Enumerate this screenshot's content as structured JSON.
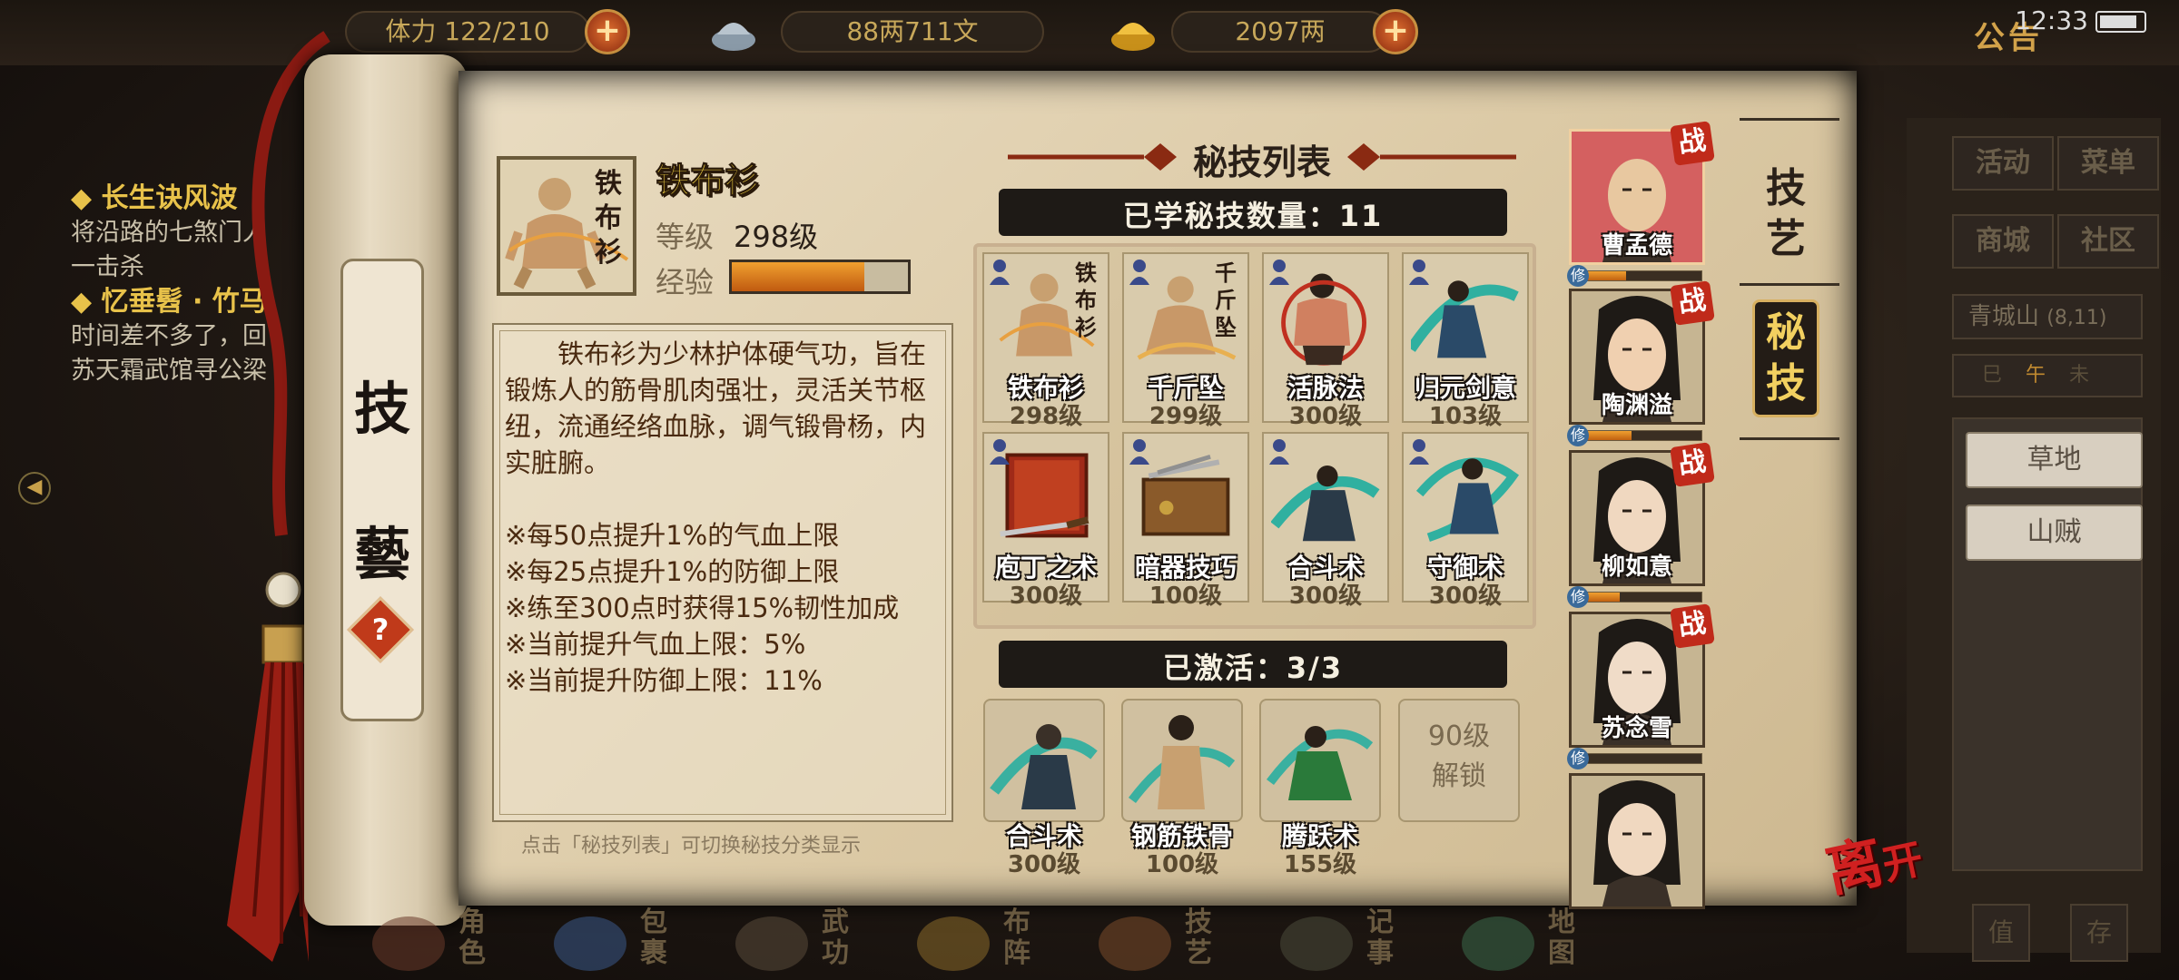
{
  "topbar": {
    "resource1_label": "体力",
    "resource1_value": "122/210",
    "resource2_value": "88两711文",
    "resource3_value": "2097两",
    "announcement": "公告",
    "time": "12:33"
  },
  "quest": {
    "q1_title": "长生诀风波",
    "q1_text_1": "将沿路的七煞门人",
    "q1_text_2": "一击杀",
    "q2_title": "忆垂髫 · 竹马",
    "q2_text_1": "时间差不多了，回",
    "q2_text_2": "苏天霜武馆寻公梁"
  },
  "scroll": {
    "char1": "技",
    "char2": "藝",
    "help": "?"
  },
  "selected_skill": {
    "name": "铁布衫",
    "portrait_text": "铁布衫",
    "level_label": "等级",
    "level_value": "298级",
    "exp_label": "经验",
    "exp_progress": 0.75
  },
  "description": {
    "intro": "铁布衫为少林护体硬气功，旨在锻炼人的筋骨肌肉强壮，灵活关节枢纽，流通经络血脉，调气锻骨杨，内实脏腑。",
    "effects": [
      "※每50点提升1%的气血上限",
      "※每25点提升1%的防御上限",
      "※练至300点时获得15%韧性加成",
      "※当前提升气血上限：5%",
      "※当前提升防御上限：11%"
    ],
    "hint": "点击「秘技列表」可切换秘技分类显示"
  },
  "list": {
    "title": "秘技列表",
    "learned_count": "已学秘技数量：11",
    "skills": [
      {
        "name": "铁布衫",
        "level": "298级",
        "icon": "bald-monk",
        "portrait_text": "铁布衫"
      },
      {
        "name": "千斤坠",
        "level": "299级",
        "icon": "meditating-monk",
        "portrait_text": "千斤坠"
      },
      {
        "name": "活脉法",
        "level": "300级",
        "icon": "muscle-fighter"
      },
      {
        "name": "归元剑意",
        "level": "103级",
        "icon": "swordsman"
      },
      {
        "name": "庖丁之术",
        "level": "300级",
        "icon": "red-book"
      },
      {
        "name": "暗器技巧",
        "level": "100级",
        "icon": "weapon-box"
      },
      {
        "name": "合斗术",
        "level": "300级",
        "icon": "dual-fighter"
      },
      {
        "name": "守御术",
        "level": "300级",
        "icon": "defense-fighter"
      }
    ],
    "activated_label": "已激活：3/3",
    "activated": [
      {
        "name": "合斗术",
        "level": "300级"
      },
      {
        "name": "钢筋铁骨",
        "level": "100级"
      },
      {
        "name": "腾跃术",
        "level": "155级"
      }
    ],
    "locked_line1": "90级",
    "locked_line2": "解锁"
  },
  "characters": [
    {
      "name": "曹孟德",
      "badge": "战",
      "xp": 0.35
    },
    {
      "name": "陶渊溢",
      "badge": "战",
      "xp": 0.4
    },
    {
      "name": "柳如意",
      "badge": "战",
      "xp": 0.3
    },
    {
      "name": "苏念雪",
      "badge": "战",
      "xp": 0.0
    },
    {
      "name": "",
      "badge": "",
      "xp": 0.0
    }
  ],
  "character_marker": "修",
  "tabs": {
    "jiyi": "技艺",
    "miji": "秘技"
  },
  "right_panel": {
    "btn_activity": "活动",
    "btn_menu": "菜单",
    "btn_shop": "商城",
    "btn_community": "社区",
    "location": "青城山",
    "coord": "(8,11)",
    "compass": [
      "巳",
      "午",
      "未"
    ],
    "npcs": [
      "草地",
      "山贼"
    ],
    "bottom_btn_1": "值",
    "bottom_btn_2": "存"
  },
  "leave": {
    "char1": "离",
    "char2": "开"
  },
  "nav": [
    {
      "label": "角色"
    },
    {
      "label": "包裹"
    },
    {
      "label": "武功"
    },
    {
      "label": "布阵"
    },
    {
      "label": "技艺"
    },
    {
      "label": "记事"
    },
    {
      "label": "地图"
    }
  ],
  "colors": {
    "paper": "#dccaa6",
    "skill_name": "#f0d040",
    "accent_red": "#c02a1a",
    "exp_fill": "#e08020"
  }
}
